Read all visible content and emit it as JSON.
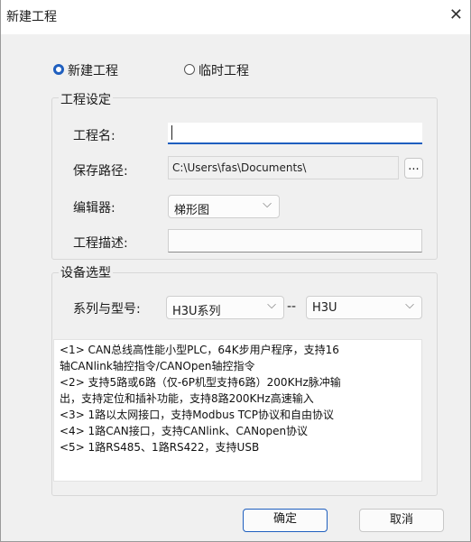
{
  "window": {
    "title": "新建工程",
    "close_glyph": "✕"
  },
  "project_type": {
    "new_label": "新建工程",
    "temp_label": "临时工程",
    "selected": "new"
  },
  "settings": {
    "group_label": "工程设定",
    "name_label": "工程名:",
    "name_value": "",
    "path_label": "保存路径:",
    "path_value": "C:\\Users\\fas\\Documents\\",
    "browse_label": "...",
    "editor_label": "编辑器:",
    "editor_value": "梯形图",
    "desc_label": "工程描述:",
    "desc_value": ""
  },
  "device": {
    "group_label": "设备选型",
    "series_label": "系列与型号:",
    "series_value": "H3U系列",
    "separator": "--",
    "model_value": "H3U",
    "features": [
      "<1> CAN总线高性能小型PLC，64K步用户程序，支持16",
      "轴CANlink轴控指令/CANOpen轴控指令",
      "<2> 支持5路或6路（仅-6P机型支持6路）200KHz脉冲输",
      "出，支持定位和插补功能，支持8路200KHz高速输入",
      "<3> 1路以太网接口，支持Modbus TCP协议和自由协议",
      "<4> 1路CAN接口，支持CANlink、CANopen协议",
      "<5> 1路RS485、1路RS422，支持USB"
    ]
  },
  "buttons": {
    "ok": "确定",
    "cancel": "取消"
  },
  "colors": {
    "accent": "#1f5fbf",
    "dialog_bg": "#f0f0f0"
  }
}
